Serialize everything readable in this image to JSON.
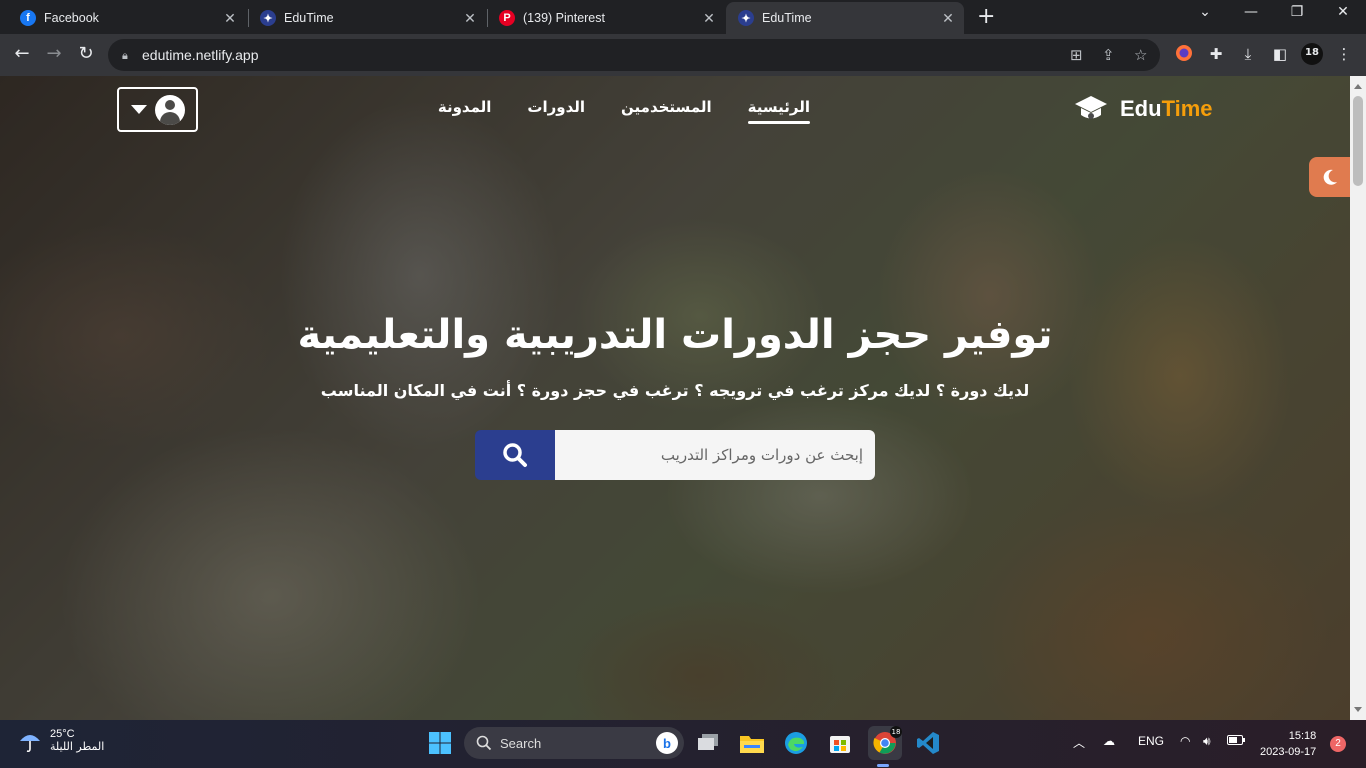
{
  "browser": {
    "tabs": [
      {
        "label": "Facebook",
        "icon": "facebook-icon",
        "active": false
      },
      {
        "label": "EduTime",
        "icon": "edutime-icon",
        "active": false
      },
      {
        "label": "(139) Pinterest",
        "icon": "pinterest-icon",
        "active": false
      },
      {
        "label": "EduTime",
        "icon": "edutime-icon",
        "active": true
      }
    ],
    "url": "edutime.netlify.app",
    "profile_badge": "18"
  },
  "site": {
    "brand_edu": "Edu",
    "brand_time": "Time",
    "nav": [
      {
        "label": "الرئيسية",
        "active": true
      },
      {
        "label": "المستخدمين",
        "active": false
      },
      {
        "label": "الدورات",
        "active": false
      },
      {
        "label": "المدونة",
        "active": false
      }
    ],
    "hero_title": "توفير حجز الدورات التدريبية والتعليمية",
    "hero_subtitle": "لديك دورة ؟ لديك مركز ترغب في ترويجه ؟ ترغب في حجز دورة ؟ أنت في المكان المناسب",
    "search_placeholder": "إبحث عن دورات ومراكز التدريب",
    "search_value": "",
    "colors": {
      "accent": "#f59e0b",
      "search_button": "#2b3e8f",
      "theme_toggle": "#e07b4f"
    }
  },
  "taskbar": {
    "weather_temp": "25°C",
    "weather_desc": "المطر الليلة",
    "search_label": "Search",
    "language": "ENG",
    "time": "15:18",
    "date": "2023-09-17",
    "notifications": "2",
    "chrome_badge": "18"
  }
}
